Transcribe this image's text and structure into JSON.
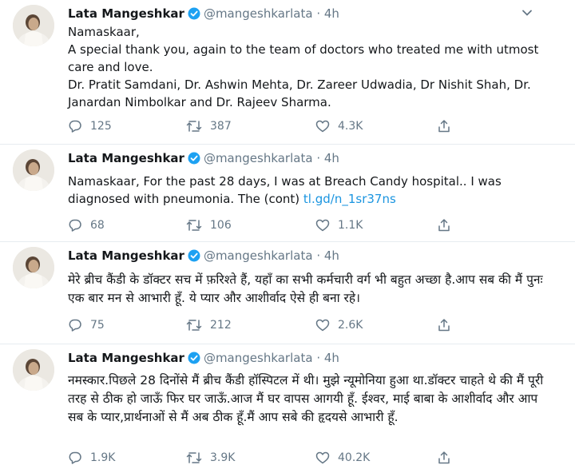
{
  "tweets": [
    {
      "name": "Lata Mangeshkar",
      "handle": "@mangeshkarlata",
      "dot": "·",
      "time": "4h",
      "lines": [
        "Namaskaar,",
        "A special thank you, again to the team of doctors who treated me with utmost care and love.",
        "Dr. Pratit Samdani, Dr. Ashwin Mehta, Dr. Zareer Udwadia, Dr Nishit Shah, Dr. Janardan Nimbolkar and Dr. Rajeev Sharma."
      ],
      "replies": "125",
      "retweets": "387",
      "likes": "4.3K"
    },
    {
      "name": "Lata Mangeshkar",
      "handle": "@mangeshkarlata",
      "dot": "·",
      "time": "4h",
      "text": "Namaskaar, For the past 28 days, I was at Breach Candy hospital.. I was diagnosed with pneumonia. The (cont) ",
      "link": "tl.gd/n_1sr37ns",
      "replies": "68",
      "retweets": "106",
      "likes": "1.1K"
    },
    {
      "name": "Lata Mangeshkar",
      "handle": "@mangeshkarlata",
      "dot": "·",
      "time": "4h",
      "text": "मेरे ब्रीच कैंडी के डॉक्टर सच में फ़रिश्ते हैं, यहाँ का सभी कर्मचारी वर्ग भी बहुत अच्छा है.आप सब की मैं पुनः एक बार मन से आभारी हूँ. ये प्यार और आशीर्वाद ऐसे ही बना रहे।",
      "replies": "75",
      "retweets": "212",
      "likes": "2.6K"
    },
    {
      "name": "Lata Mangeshkar",
      "handle": "@mangeshkarlata",
      "dot": "·",
      "time": "4h",
      "text": "नमस्कार.पिछले 28 दिनोंसे मैं ब्रीच कैंडी हॉस्पिटल में थी। मुझे न्यूमोनिया हुआ था.डॉक्टर चाहते थे की मैं पूरी तरह से ठीक हो जाऊँ फिर घर जाऊँ.आज मैं घर वापस आगयी हूँ. ईश्वर, माई बाबा के आशीर्वाद और आप सब के प्यार,प्रार्थनाओं से मैं अब ठीक हूँ.मैं आप सबे की हृदयसे आभारी हूँ.",
      "replies": "1.9K",
      "retweets": "3.9K",
      "likes": "40.2K"
    }
  ],
  "colors": {
    "accent": "#1da1f2",
    "link": "#1b95e0",
    "muted": "#657786",
    "text": "#14171a",
    "divider": "#e6ecf0"
  },
  "icons": {
    "verified": "verified-badge-icon",
    "caret": "chevron-down-icon",
    "reply": "reply-icon",
    "retweet": "retweet-icon",
    "like": "heart-icon",
    "share": "share-icon"
  }
}
